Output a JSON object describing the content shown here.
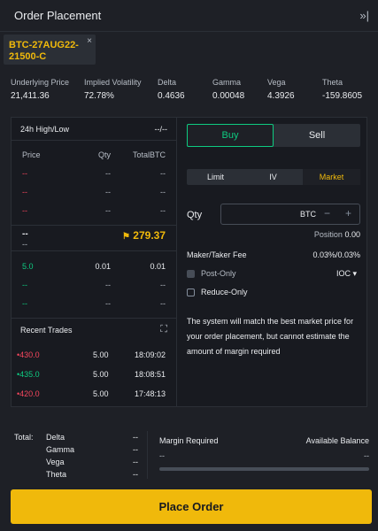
{
  "header": {
    "title": "Order Placement",
    "collapse_icon": "»|"
  },
  "instrument_tab": {
    "name": "BTC-27AUG22-21500-C",
    "close": "×"
  },
  "greeks": [
    {
      "label": "Underlying Price",
      "value": "21,411.36"
    },
    {
      "label": "Implied Volatility",
      "value": "72.78%"
    },
    {
      "label": "Delta",
      "value": "0.4636"
    },
    {
      "label": "Gamma",
      "value": "0.00048"
    },
    {
      "label": "Vega",
      "value": "4.3926"
    },
    {
      "label": "Theta",
      "value": "-159.8605"
    }
  ],
  "orderbook": {
    "high_low_label": "24h High/Low",
    "high_low_value": "--/--",
    "columns": [
      "Price",
      "Qty",
      "TotalBTC"
    ],
    "asks": [
      {
        "price": "--",
        "qty": "--",
        "total": "--"
      },
      {
        "price": "--",
        "qty": "--",
        "total": "--"
      },
      {
        "price": "--",
        "qty": "--",
        "total": "--"
      }
    ],
    "last_price": "--",
    "last_price_sub": "--",
    "mark_price": "279.37",
    "bids": [
      {
        "price": "5.0",
        "qty": "0.01",
        "total": "0.01"
      },
      {
        "price": "--",
        "qty": "--",
        "total": "--"
      },
      {
        "price": "--",
        "qty": "--",
        "total": "--"
      }
    ]
  },
  "recent_trades": {
    "title": "Recent Trades",
    "trades": [
      {
        "price": "430.0",
        "qty": "5.00",
        "time": "18:09:02",
        "side": "sell"
      },
      {
        "price": "435.0",
        "qty": "5.00",
        "time": "18:08:51",
        "side": "buy"
      },
      {
        "price": "420.0",
        "qty": "5.00",
        "time": "17:48:13",
        "side": "sell"
      }
    ]
  },
  "order_form": {
    "buy_label": "Buy",
    "sell_label": "Sell",
    "order_types": [
      "Limit",
      "IV",
      "Market"
    ],
    "active_order_type": "Market",
    "qty_label": "Qty",
    "qty_unit": "BTC",
    "position_label": "Position",
    "position_value": "0.00",
    "fee_label": "Maker/Taker Fee",
    "fee_value": "0.03%/0.03%",
    "post_only_label": "Post-Only",
    "reduce_only_label": "Reduce-Only",
    "time_in_force": "IOC",
    "note": "The system will match the best market price for your order placement, but cannot estimate the amount of margin required"
  },
  "summary": {
    "total_label": "Total:",
    "greeks": [
      {
        "label": "Delta",
        "value": "--"
      },
      {
        "label": "Gamma",
        "value": "--"
      },
      {
        "label": "Vega",
        "value": "--"
      },
      {
        "label": "Theta",
        "value": "--"
      }
    ],
    "margin_required_label": "Margin Required",
    "margin_required_value": "--",
    "available_balance_label": "Available Balance",
    "available_balance_value": "--"
  },
  "place_order_label": "Place Order",
  "colors": {
    "accent": "#f0b90b",
    "buy": "#0ecb81",
    "sell": "#f6465d",
    "background": "#1e2026"
  }
}
